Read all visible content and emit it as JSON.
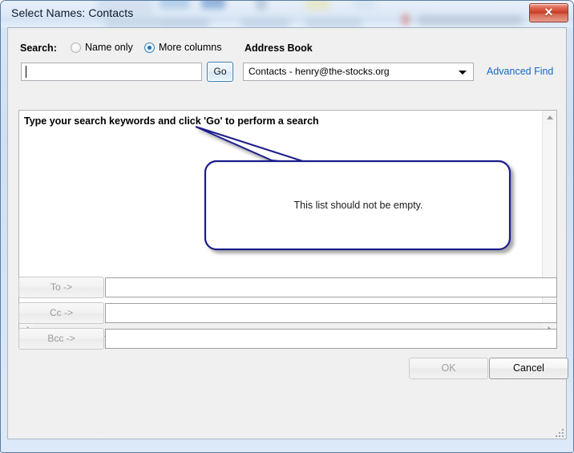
{
  "window": {
    "title": "Select Names: Contacts",
    "close_icon": "close-icon",
    "close_glyph": "✕"
  },
  "search": {
    "label": "Search:",
    "input_value": "",
    "input_placeholder": "",
    "go_label": "Go",
    "options": [
      {
        "label": "Name only",
        "selected": false
      },
      {
        "label": "More columns",
        "selected": true
      }
    ]
  },
  "address_book": {
    "label": "Address Book",
    "selected": "Contacts - henry@the-stocks.org",
    "options": [
      "Contacts - henry@the-stocks.org"
    ],
    "advanced_find_label": "Advanced Find"
  },
  "list": {
    "hint": "Type your search keywords and click 'Go' to perform a search",
    "rows": []
  },
  "recipients": [
    {
      "button_label": "To ->",
      "value": "",
      "enabled": false
    },
    {
      "button_label": "Cc ->",
      "value": "",
      "enabled": false
    },
    {
      "button_label": "Bcc ->",
      "value": "",
      "enabled": false
    }
  ],
  "footer": {
    "ok_label": "OK",
    "ok_enabled": false,
    "cancel_label": "Cancel",
    "cancel_enabled": true
  },
  "annotation": {
    "text": "This list should not be empty.",
    "color": "#1a1a8c"
  },
  "colors": {
    "accent_link": "#1569c7",
    "close_button": "#c63a22",
    "frame": "#5a7ca0",
    "annotation": "#1a1a8c"
  }
}
